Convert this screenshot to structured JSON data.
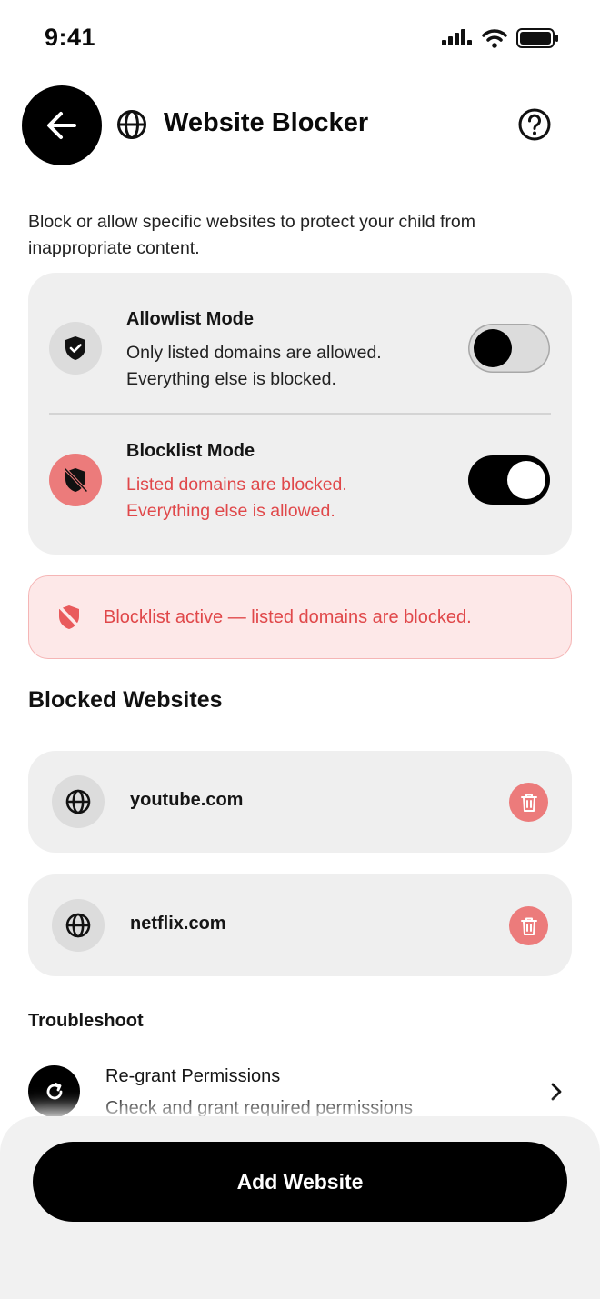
{
  "status_bar": {
    "time": "9:41",
    "icons": [
      "cellular-signal-icon",
      "wifi-icon",
      "battery-icon"
    ]
  },
  "header": {
    "back_icon": "arrow-left-icon",
    "globe_icon": "globe-icon",
    "title": "Website Blocker",
    "help_icon": "question-circle-icon"
  },
  "description": "Block or allow specific websites to protect your child from inappropriate content.",
  "modes": {
    "allowlist": {
      "title": "Allowlist Mode",
      "line1": "Only listed domains are allowed.",
      "line2": "Everything else is blocked.",
      "icon": "shield-check-icon",
      "enabled": false
    },
    "blocklist": {
      "title": "Blocklist Mode",
      "line1": "Listed domains are blocked.",
      "line2": "Everything else is allowed.",
      "icon": "shield-off-icon",
      "enabled": true
    }
  },
  "alert": {
    "text": "Blocklist active — listed domains are blocked.",
    "icon": "shield-off-icon"
  },
  "blocked_section": {
    "title": "Blocked Websites",
    "sites": [
      {
        "domain": "youtube.com",
        "icon": "globe-icon",
        "action_icon": "trash-icon"
      },
      {
        "domain": "netflix.com",
        "icon": "globe-icon",
        "action_icon": "trash-icon"
      }
    ]
  },
  "troubleshoot": {
    "title": "Troubleshoot",
    "regrant_title": "Re-grant Permissions",
    "regrant_desc": "Check and grant required permissions",
    "icon": "refresh-icon",
    "chevron": "chevron-right-icon"
  },
  "footer": {
    "add_button_label": "Add Website"
  },
  "colors": {
    "accent_red": "#e0484a",
    "icon_red_bg": "#ec7b7b",
    "alert_bg": "#fde8e8",
    "card_bg": "#efefef",
    "primary_black": "#000000"
  }
}
